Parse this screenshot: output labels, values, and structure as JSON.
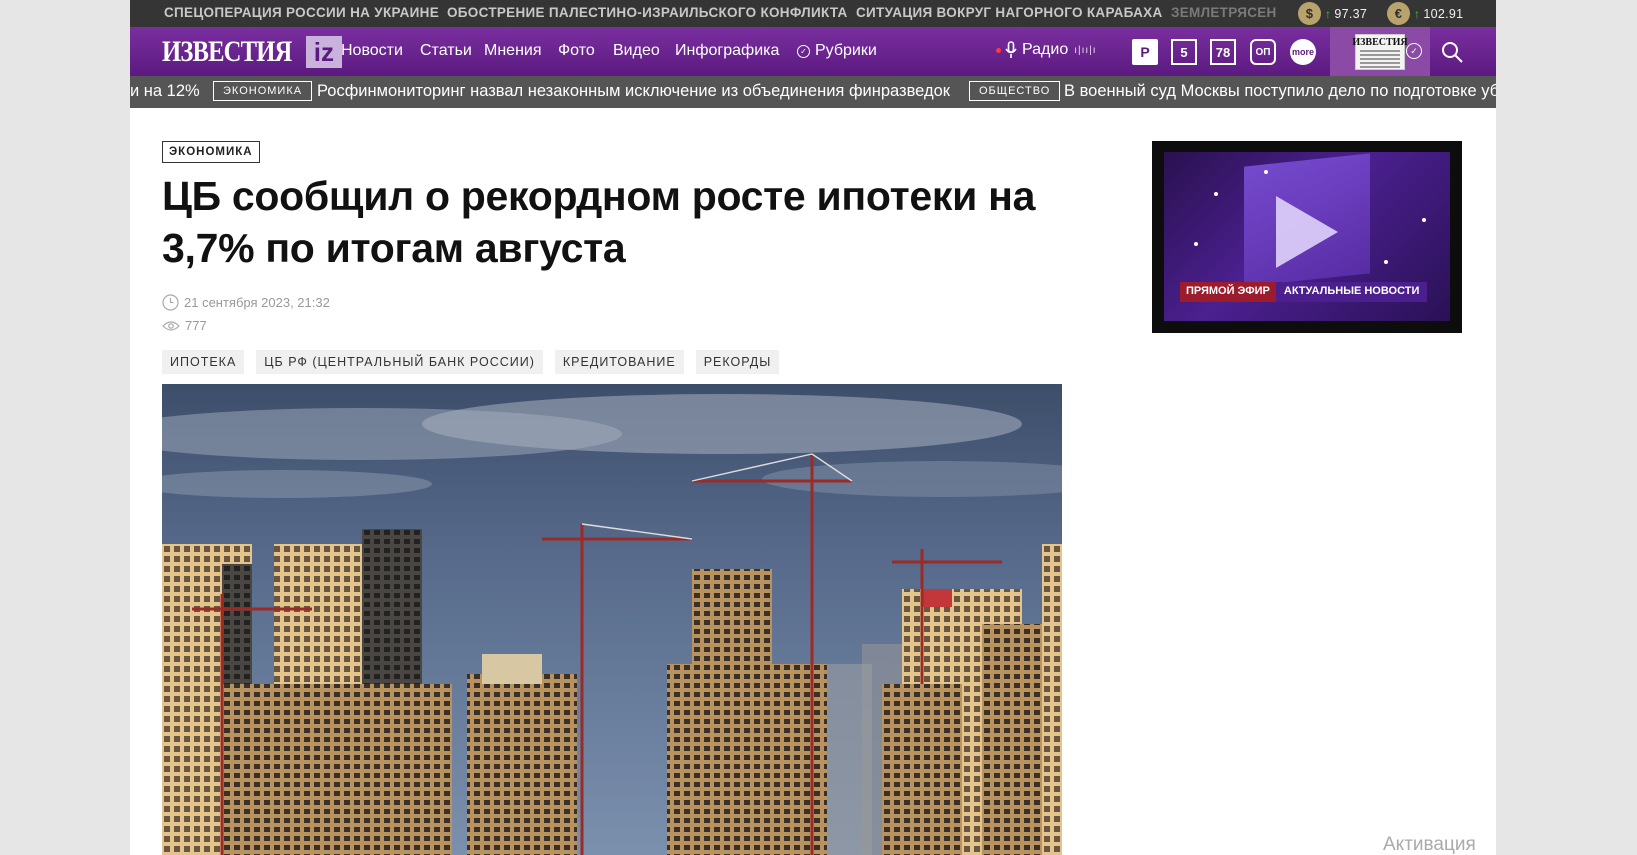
{
  "top_strip": {
    "trends": [
      "СПЕЦОПЕРАЦИЯ РОССИИ НА УКРАИНЕ",
      "ОБОСТРЕНИЕ ПАЛЕСТИНО-ИЗРАИЛЬСКОГО КОНФЛИКТА",
      "СИТУАЦИЯ ВОКРУГ НАГОРНОГО КАРАБАХА",
      "ЗЕМЛЕТРЯСЕН"
    ],
    "rates": [
      {
        "symbol": "$",
        "value": "97.37"
      },
      {
        "symbol": "€",
        "value": "102.91"
      }
    ]
  },
  "nav": {
    "logo_text": "ИЗВЕСТИЯ",
    "logo_badge": "iz",
    "items": [
      "Новости",
      "Статьи",
      "Мнения",
      "Фото",
      "Видео",
      "Инфографика",
      "Рубрики"
    ],
    "radio_label": "Радио",
    "radio_wave": "ı|ıı|ı",
    "channels": [
      "Р",
      "5",
      "78",
      "ОП",
      "more"
    ],
    "paper_title": "ИЗВЕСТИЯ"
  },
  "ticker": {
    "items": [
      {
        "text": "и на 12%"
      },
      {
        "tag": "ЭКОНОМИКА",
        "text": "Росфинмониторинг назвал незаконным исключение из объединения финразведок"
      },
      {
        "tag": "ОБЩЕСТВО",
        "text": "В военный суд Москвы поступило дело по подготовке уб"
      }
    ]
  },
  "article": {
    "rubric": "ЭКОНОМИКА",
    "title": "ЦБ сообщил о рекордном росте ипотеки на 3,7% по итогам августа",
    "date": "21 сентября 2023, 21:32",
    "views": "777",
    "tags": [
      "ИПОТЕКА",
      "ЦБ РФ (ЦЕНТРАЛЬНЫЙ БАНК РОССИИ)",
      "КРЕДИТОВАНИЕ",
      "РЕКОРДЫ"
    ]
  },
  "player": {
    "live_label": "ПРЯМОЙ ЭФИР",
    "news_label": "АКТУАЛЬНЫЕ НОВОСТИ"
  },
  "watermark": "Активация Windows",
  "colors": {
    "nav_purple": "#6a2590",
    "accent_light": "#c9b3dd",
    "ticker_bg": "#555555",
    "top_strip_bg": "#353535"
  }
}
